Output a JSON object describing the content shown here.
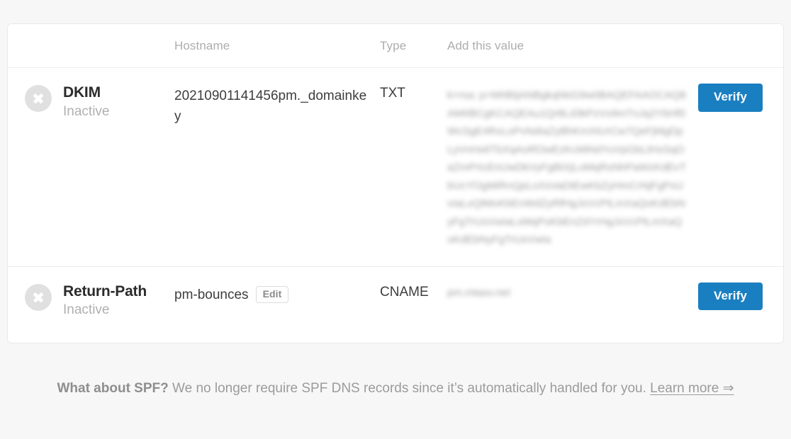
{
  "table": {
    "columns": [
      {
        "key": "status",
        "label": ""
      },
      {
        "key": "hostname",
        "label": "Hostname"
      },
      {
        "key": "type",
        "label": "Type"
      },
      {
        "key": "value",
        "label": "Add this value"
      },
      {
        "key": "action",
        "label": ""
      }
    ],
    "rows": [
      {
        "status_icon": "x-circle-icon",
        "record": "DKIM",
        "state": "Inactive",
        "hostname": "20210901141456pm._domainkey",
        "has_edit": false,
        "edit_label": "",
        "type": "TXT",
        "value_redacted": true,
        "value_placeholder": "k=rsa; p=MIIBIjANBgkqhkiG9w0BAQEFAAOCAQ8AMIIBCgKCAQEAu1Qr8Ld3kPzVx9mTnJq2YbHf0WcSgE4RxLoPvNdIaZyBhKmXtUrCw7QeFjMgDpLyVnHs6TbXqAoRfJwEzKcMiNdYuVpGbLtHxSqOaZmPrIcEnUwDkVyFgBtXjLoMqRsNhPaWzKdEvTbUcYfJgMiRnQpLoXsVaDtEwKbZyHmCrNjFgPsUvIaLxQtMoKbEnWdZyRfHgJsVcPtLmXaQoKdEbNyFgTrUsVwIaLxMqPoKbEnZdYrHgJsVcPtLmXaQoKdEbNyFgTrUsVwIa",
        "action_label": "Verify"
      },
      {
        "status_icon": "x-circle-icon",
        "record": "Return-Path",
        "state": "Inactive",
        "hostname": "pm-bounces",
        "has_edit": true,
        "edit_label": "Edit",
        "type": "CNAME",
        "value_redacted": true,
        "value_placeholder": "pm.mtasv.net",
        "action_label": "Verify"
      }
    ]
  },
  "footer": {
    "heading": "What about SPF?",
    "body": " We no longer require SPF DNS records since it’s automatically handled for you. ",
    "link_label": "Learn more",
    "link_arrow": "⇒"
  },
  "colors": {
    "accent": "#1a7fc1",
    "muted_text": "#9b9b9b",
    "header_text": "#adadad",
    "status_inactive": "#e0e0e0",
    "page_bg": "#f7f7f7",
    "card_bg": "#ffffff",
    "border": "#ededed"
  }
}
